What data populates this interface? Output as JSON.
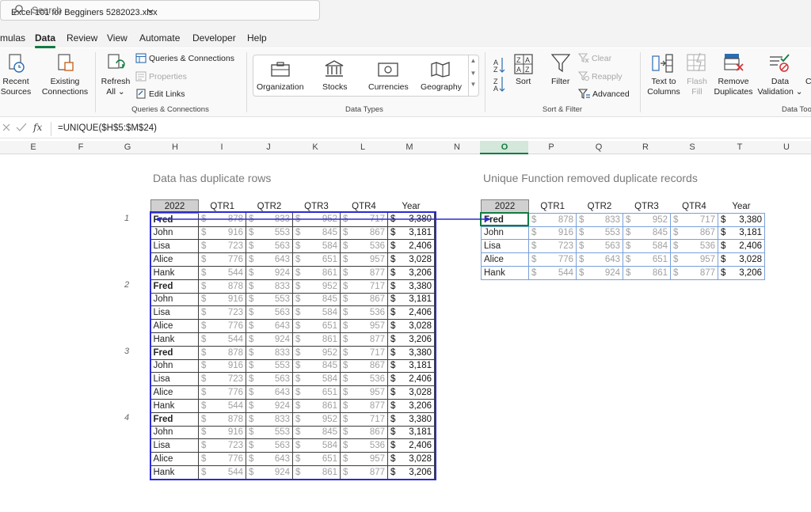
{
  "window": {
    "filename": "Excel 101 for Begginers 5282023.xlsx",
    "search_placeholder": "Search"
  },
  "menu": [
    "mulas",
    "Data",
    "Review",
    "View",
    "Automate",
    "Developer",
    "Help"
  ],
  "menu_active": "Data",
  "ribbon": {
    "recent_sources": [
      "Recent",
      "Sources"
    ],
    "existing_connections": [
      "Existing",
      "Connections"
    ],
    "refresh_all": [
      "Refresh",
      "All"
    ],
    "queries_connections": "Queries & Connections",
    "properties": "Properties",
    "edit_links": "Edit Links",
    "group_queries": "Queries & Connections",
    "data_types": [
      "Organization",
      "Stocks",
      "Currencies",
      "Geography"
    ],
    "group_data_types": "Data Types",
    "sort_label": "Sort",
    "filter_label": "Filter",
    "clear_label": "Clear",
    "reapply_label": "Reapply",
    "advanced_label": "Advanced",
    "group_sort_filter": "Sort & Filter",
    "text_to_columns": [
      "Text to",
      "Columns"
    ],
    "flash_fill": [
      "Flash",
      "Fill"
    ],
    "remove_duplicates": [
      "Remove",
      "Duplicates"
    ],
    "data_validation": [
      "Data",
      "Validation"
    ],
    "group_data_tools": "Data Tools"
  },
  "formula_bar": {
    "fx": "fx",
    "formula": "=UNIQUE($H$5:$M$24)"
  },
  "columns": [
    "E",
    "F",
    "G",
    "H",
    "I",
    "J",
    "K",
    "L",
    "M",
    "N",
    "O",
    "P",
    "Q",
    "R",
    "S",
    "T",
    "U"
  ],
  "selected_column": "O",
  "left_title": "Data has duplicate rows",
  "right_title": "Unique Function removed duplicate records",
  "headers": [
    "2022",
    "QTR1",
    "QTR2",
    "QTR3",
    "QTR4",
    "Year"
  ],
  "group_numbers": [
    "1",
    "2",
    "3",
    "4"
  ],
  "rows_source": [
    {
      "name": "Fred",
      "q": [
        "878",
        "833",
        "952",
        "717"
      ],
      "year": "3,380"
    },
    {
      "name": "John",
      "q": [
        "916",
        "553",
        "845",
        "867"
      ],
      "year": "3,181"
    },
    {
      "name": "Lisa",
      "q": [
        "723",
        "563",
        "584",
        "536"
      ],
      "year": "2,406"
    },
    {
      "name": "Alice",
      "q": [
        "776",
        "643",
        "651",
        "957"
      ],
      "year": "3,028"
    },
    {
      "name": "Hank",
      "q": [
        "544",
        "924",
        "861",
        "877"
      ],
      "year": "3,206"
    }
  ],
  "repeat_count": 4,
  "currency_symbol": "$",
  "unique_rows": [
    {
      "name": "Fred",
      "q": [
        "878",
        "833",
        "952",
        "717"
      ],
      "year": "3,380"
    },
    {
      "name": "John",
      "q": [
        "916",
        "553",
        "845",
        "867"
      ],
      "year": "3,181"
    },
    {
      "name": "Lisa",
      "q": [
        "723",
        "563",
        "584",
        "536"
      ],
      "year": "2,406"
    },
    {
      "name": "Alice",
      "q": [
        "776",
        "643",
        "651",
        "957"
      ],
      "year": "3,028"
    },
    {
      "name": "Hank",
      "q": [
        "544",
        "924",
        "861",
        "877"
      ],
      "year": "3,206"
    }
  ],
  "colors": {
    "accent": "#107c41",
    "source_border": "#2b2bd6",
    "spill_border": "#7aa0d8"
  }
}
